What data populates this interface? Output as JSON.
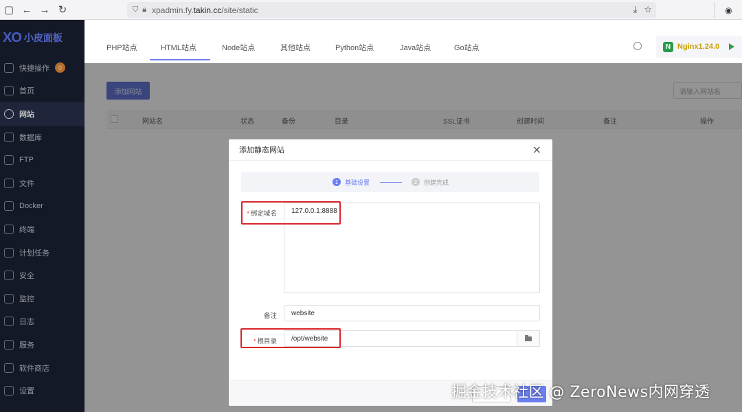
{
  "browser": {
    "url_prefix": "xpadmin.fy.",
    "url_domain": "takin.cc",
    "url_path": "/site/static"
  },
  "sidebar": {
    "logo_mark": "XO",
    "logo_text": "小皮面板",
    "items": [
      {
        "label": "快捷操作",
        "badge": "0"
      },
      {
        "label": "首页"
      },
      {
        "label": "网站",
        "active": true
      },
      {
        "label": "数据库"
      },
      {
        "label": "FTP"
      },
      {
        "label": "文件"
      },
      {
        "label": "Docker"
      },
      {
        "label": "终端"
      },
      {
        "label": "计划任务"
      },
      {
        "label": "安全"
      },
      {
        "label": "监控"
      },
      {
        "label": "日志"
      },
      {
        "label": "服务"
      },
      {
        "label": "软件商店"
      },
      {
        "label": "设置"
      }
    ]
  },
  "tabs": {
    "items": [
      "PHP站点",
      "HTML站点",
      "Node站点",
      "其他站点",
      "Python站点",
      "Java站点",
      "Go站点"
    ],
    "active_index": 1,
    "nginx_label": "Nginx1.24.0"
  },
  "main": {
    "add_site_label": "添加网站",
    "search_placeholder": "请输入网站名",
    "columns": [
      "网站名",
      "状态",
      "备份",
      "目录",
      "SSL证书",
      "创建时间",
      "备注",
      "操作"
    ]
  },
  "modal": {
    "title": "添加静态网站",
    "steps": [
      {
        "num": "1",
        "label": "基础设置"
      },
      {
        "num": "2",
        "label": "创建完成"
      }
    ],
    "domain_label": "绑定域名",
    "domain_value": "127.0.0.1:8888",
    "note_label": "备注",
    "note_value": "website",
    "root_label": "根目录",
    "root_value": "/opt/website"
  },
  "watermark": "掘金技术社区 @ ZeroNews内网穿透",
  "colors": {
    "sidebar_bg": "#1b2236",
    "accent": "#6b7ff0",
    "highlight_box": "#d9252b",
    "nginx_text": "#c9a000"
  }
}
